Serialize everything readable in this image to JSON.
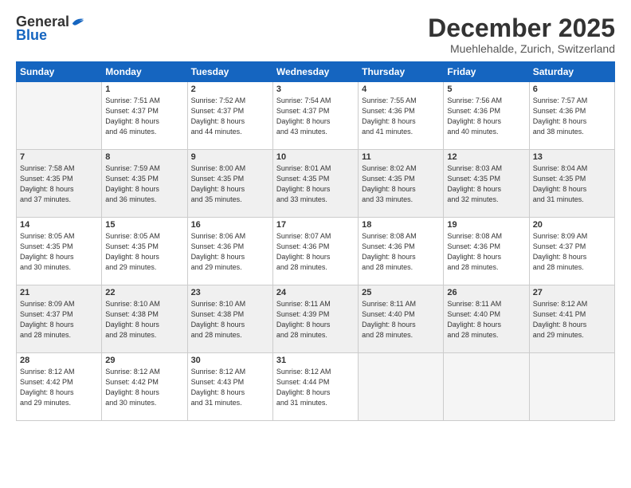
{
  "logo": {
    "general": "General",
    "blue": "Blue"
  },
  "title": "December 2025",
  "subtitle": "Muehlehalde, Zurich, Switzerland",
  "days_of_week": [
    "Sunday",
    "Monday",
    "Tuesday",
    "Wednesday",
    "Thursday",
    "Friday",
    "Saturday"
  ],
  "weeks": [
    [
      {
        "day": "",
        "info": ""
      },
      {
        "day": "1",
        "info": "Sunrise: 7:51 AM\nSunset: 4:37 PM\nDaylight: 8 hours\nand 46 minutes."
      },
      {
        "day": "2",
        "info": "Sunrise: 7:52 AM\nSunset: 4:37 PM\nDaylight: 8 hours\nand 44 minutes."
      },
      {
        "day": "3",
        "info": "Sunrise: 7:54 AM\nSunset: 4:37 PM\nDaylight: 8 hours\nand 43 minutes."
      },
      {
        "day": "4",
        "info": "Sunrise: 7:55 AM\nSunset: 4:36 PM\nDaylight: 8 hours\nand 41 minutes."
      },
      {
        "day": "5",
        "info": "Sunrise: 7:56 AM\nSunset: 4:36 PM\nDaylight: 8 hours\nand 40 minutes."
      },
      {
        "day": "6",
        "info": "Sunrise: 7:57 AM\nSunset: 4:36 PM\nDaylight: 8 hours\nand 38 minutes."
      }
    ],
    [
      {
        "day": "7",
        "info": "Sunrise: 7:58 AM\nSunset: 4:35 PM\nDaylight: 8 hours\nand 37 minutes."
      },
      {
        "day": "8",
        "info": "Sunrise: 7:59 AM\nSunset: 4:35 PM\nDaylight: 8 hours\nand 36 minutes."
      },
      {
        "day": "9",
        "info": "Sunrise: 8:00 AM\nSunset: 4:35 PM\nDaylight: 8 hours\nand 35 minutes."
      },
      {
        "day": "10",
        "info": "Sunrise: 8:01 AM\nSunset: 4:35 PM\nDaylight: 8 hours\nand 33 minutes."
      },
      {
        "day": "11",
        "info": "Sunrise: 8:02 AM\nSunset: 4:35 PM\nDaylight: 8 hours\nand 33 minutes."
      },
      {
        "day": "12",
        "info": "Sunrise: 8:03 AM\nSunset: 4:35 PM\nDaylight: 8 hours\nand 32 minutes."
      },
      {
        "day": "13",
        "info": "Sunrise: 8:04 AM\nSunset: 4:35 PM\nDaylight: 8 hours\nand 31 minutes."
      }
    ],
    [
      {
        "day": "14",
        "info": "Sunrise: 8:05 AM\nSunset: 4:35 PM\nDaylight: 8 hours\nand 30 minutes."
      },
      {
        "day": "15",
        "info": "Sunrise: 8:05 AM\nSunset: 4:35 PM\nDaylight: 8 hours\nand 29 minutes."
      },
      {
        "day": "16",
        "info": "Sunrise: 8:06 AM\nSunset: 4:36 PM\nDaylight: 8 hours\nand 29 minutes."
      },
      {
        "day": "17",
        "info": "Sunrise: 8:07 AM\nSunset: 4:36 PM\nDaylight: 8 hours\nand 28 minutes."
      },
      {
        "day": "18",
        "info": "Sunrise: 8:08 AM\nSunset: 4:36 PM\nDaylight: 8 hours\nand 28 minutes."
      },
      {
        "day": "19",
        "info": "Sunrise: 8:08 AM\nSunset: 4:36 PM\nDaylight: 8 hours\nand 28 minutes."
      },
      {
        "day": "20",
        "info": "Sunrise: 8:09 AM\nSunset: 4:37 PM\nDaylight: 8 hours\nand 28 minutes."
      }
    ],
    [
      {
        "day": "21",
        "info": "Sunrise: 8:09 AM\nSunset: 4:37 PM\nDaylight: 8 hours\nand 28 minutes."
      },
      {
        "day": "22",
        "info": "Sunrise: 8:10 AM\nSunset: 4:38 PM\nDaylight: 8 hours\nand 28 minutes."
      },
      {
        "day": "23",
        "info": "Sunrise: 8:10 AM\nSunset: 4:38 PM\nDaylight: 8 hours\nand 28 minutes."
      },
      {
        "day": "24",
        "info": "Sunrise: 8:11 AM\nSunset: 4:39 PM\nDaylight: 8 hours\nand 28 minutes."
      },
      {
        "day": "25",
        "info": "Sunrise: 8:11 AM\nSunset: 4:40 PM\nDaylight: 8 hours\nand 28 minutes."
      },
      {
        "day": "26",
        "info": "Sunrise: 8:11 AM\nSunset: 4:40 PM\nDaylight: 8 hours\nand 28 minutes."
      },
      {
        "day": "27",
        "info": "Sunrise: 8:12 AM\nSunset: 4:41 PM\nDaylight: 8 hours\nand 29 minutes."
      }
    ],
    [
      {
        "day": "28",
        "info": "Sunrise: 8:12 AM\nSunset: 4:42 PM\nDaylight: 8 hours\nand 29 minutes."
      },
      {
        "day": "29",
        "info": "Sunrise: 8:12 AM\nSunset: 4:42 PM\nDaylight: 8 hours\nand 30 minutes."
      },
      {
        "day": "30",
        "info": "Sunrise: 8:12 AM\nSunset: 4:43 PM\nDaylight: 8 hours\nand 31 minutes."
      },
      {
        "day": "31",
        "info": "Sunrise: 8:12 AM\nSunset: 4:44 PM\nDaylight: 8 hours\nand 31 minutes."
      },
      {
        "day": "",
        "info": ""
      },
      {
        "day": "",
        "info": ""
      },
      {
        "day": "",
        "info": ""
      }
    ]
  ]
}
